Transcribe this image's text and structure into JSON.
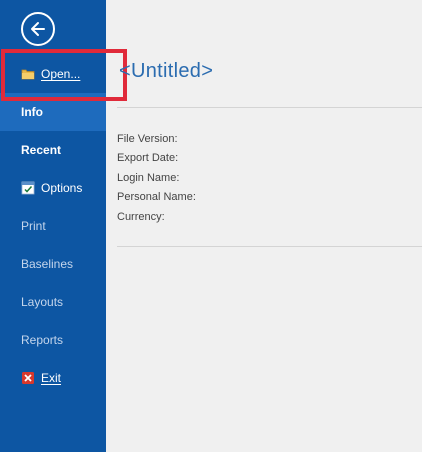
{
  "sidebar": {
    "back_icon": "arrow-left-circle-icon",
    "items": [
      {
        "label": "Open...",
        "icon": "folder-icon"
      },
      {
        "label": "Info"
      },
      {
        "label": "Recent"
      },
      {
        "label": "Options",
        "icon": "options-checkbox-icon"
      },
      {
        "label": "Print"
      },
      {
        "label": "Baselines"
      },
      {
        "label": "Layouts"
      },
      {
        "label": "Reports"
      },
      {
        "label": "Exit",
        "icon": "exit-x-icon"
      }
    ]
  },
  "main": {
    "title": "<Untitled>",
    "properties": [
      "File Version:",
      "Export Date:",
      "Login Name:",
      "Personal Name:",
      "Currency:"
    ]
  },
  "colors": {
    "sidebar_bg": "#0d56a3",
    "active_item_bg": "#1e6bbd",
    "highlight_border": "#e02a3a",
    "title_color": "#2b6cb0"
  }
}
